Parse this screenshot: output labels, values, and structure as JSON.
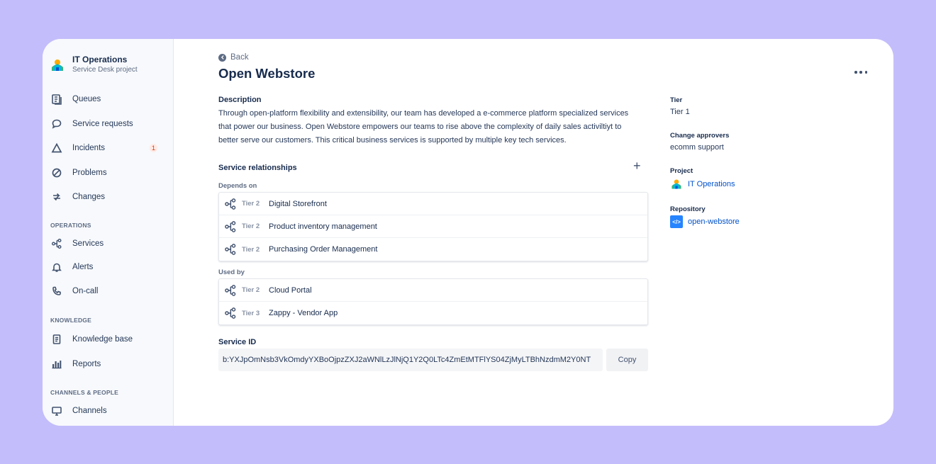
{
  "project": {
    "name": "IT Operations",
    "subtitle": "Service Desk project"
  },
  "nav": {
    "queues": "Queues",
    "service_requests": "Service requests",
    "incidents": "Incidents",
    "incidents_badge": "1",
    "problems": "Problems",
    "changes": "Changes",
    "section_operations": "OPERATIONS",
    "services": "Services",
    "alerts": "Alerts",
    "on_call": "On-call",
    "section_knowledge": "KNOWLEDGE",
    "knowledge_base": "Knowledge base",
    "reports": "Reports",
    "section_channels": "CHANNELS & PEOPLE",
    "channels": "Channels"
  },
  "page": {
    "back_label": "Back",
    "title": "Open Webstore",
    "description_label": "Description",
    "description": "Through open-platform flexibility and extensibility, our team has developed a e-commerce platform specialized services that power our business. Open Webstore empowers our teams to rise above the complexity of daily sales activiltiyt to better serve our customers. This critical business services is supported by multiple key tech services.",
    "relationships_label": "Service relationships",
    "depends_on_label": "Depends on",
    "depends_on": [
      {
        "tier": "Tier 2",
        "name": "Digital Storefront"
      },
      {
        "tier": "Tier 2",
        "name": "Product inventory management"
      },
      {
        "tier": "Tier 2",
        "name": "Purchasing Order Management"
      }
    ],
    "used_by_label": "Used by",
    "used_by": [
      {
        "tier": "Tier 2",
        "name": "Cloud Portal"
      },
      {
        "tier": "Tier 3",
        "name": "Zappy - Vendor App"
      }
    ],
    "service_id_label": "Service ID",
    "service_id": "b:YXJpOmNsb3VkOmdyYXBoOjpzZXJ2aWNlLzJlNjQ1Y2Q0LTc4ZmEtMTFlYS04ZjMyLTBhNzdmM2Y0NT",
    "copy_label": "Copy"
  },
  "details": {
    "tier_label": "Tier",
    "tier_value": "Tier 1",
    "approvers_label": "Change approvers",
    "approvers_value": "ecomm support",
    "project_label": "Project",
    "project_value": "IT Operations",
    "repo_label": "Repository",
    "repo_value": "open-webstore"
  },
  "colors": {
    "background": "#c4bdfb",
    "link": "#0052cc",
    "badge": "#de350b",
    "text": "#172b4d"
  },
  "icons": {
    "queues": "queues-icon",
    "service_requests": "speech-bubble-icon",
    "incidents": "warning-triangle-icon",
    "problems": "prohibited-icon",
    "changes": "changes-icon",
    "services": "services-icon",
    "alerts": "bell-icon",
    "on_call": "phone-icon",
    "knowledge_base": "book-icon",
    "reports": "bar-chart-icon",
    "channels": "monitor-icon",
    "more": "more-dots-icon"
  }
}
